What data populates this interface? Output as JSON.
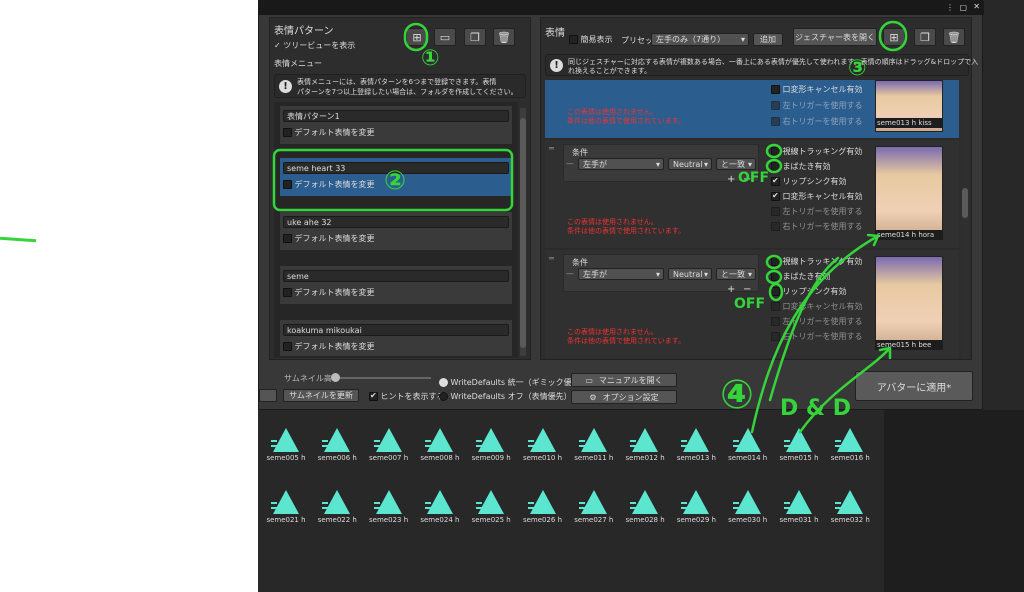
{
  "left_panel": {
    "title": "表情パターン",
    "tree_preview_label": "ツリービューを表示",
    "menu_label": "表情メニュー",
    "info_text_1": "表情メニューには、表情パターンを6つまで登録できます。表情",
    "info_text_2": "パターンを7つ以上登録したい場合は、フォルダを作成してください。",
    "default_change_label": "デフォルト表情を変更",
    "patterns": [
      {
        "name": "表情パターン1"
      },
      {
        "name": "seme heart 33"
      },
      {
        "name": "uke ahe 32"
      },
      {
        "name": "seme"
      },
      {
        "name": "koakuma mikoukai"
      }
    ]
  },
  "right_panel": {
    "title": "表情",
    "simple_display_label": "簡易表示",
    "preset_label": "プリセット",
    "preset_value": "左手のみ（7通り）",
    "add_label": "追加",
    "gesture_table_label": "ジェスチャー表を開く",
    "info_text_1": "同じジェスチャーに対応する表情が複数ある場合、一番上にある表情が優先して使われます。表情の順序はドラッグ&ドロップで入",
    "info_text_2": "れ換えることができます。",
    "condition_label": "条件",
    "hand_value": "左手が",
    "gesture_value": "Neutral",
    "match_value": "と一致",
    "warning_line_1": "この表情は使用されません。",
    "warning_line_2": "条件は他の表情で使用されています。",
    "options": {
      "eye_tracking": "視線トラッキング有効",
      "blink": "まばたき有効",
      "lip_sync": "リップシンク有効",
      "mouth_cancel": "口変形キャンセル有効",
      "left_trigger": "左トリガーを使用する",
      "right_trigger": "右トリガーを使用する"
    },
    "thumbnails": [
      {
        "caption": "seme013 h kiss"
      },
      {
        "caption": "seme014 h hora"
      },
      {
        "caption": "seme015 h bee"
      }
    ]
  },
  "bottom_bar": {
    "thumb_height_label": "サムネイル高",
    "update_thumb_label": "サムネイルを更新",
    "hint_label": "ヒントを表示する",
    "wd_on_label": "WriteDefaults 統一（ギミック優先）",
    "wd_off_label": "WriteDefaults オフ（表情優先）",
    "manual_label": "マニュアルを開く",
    "option_label": "オプション設定",
    "apply_label": "アバターに適用*"
  },
  "assets_row1": [
    "seme005 h",
    "seme006 h",
    "seme007 h",
    "seme008 h",
    "seme009 h",
    "seme010 h",
    "seme011 h",
    "seme012 h",
    "seme013 h",
    "seme014 h",
    "seme015 h",
    "seme016 h"
  ],
  "assets_row2": [
    "seme021 h",
    "seme022 h",
    "seme023 h",
    "seme024 h",
    "seme025 h",
    "seme026 h",
    "seme027 h",
    "seme028 h",
    "seme029 h",
    "seme030 h",
    "seme031 h",
    "seme032 h"
  ],
  "annotations": {
    "one": "①",
    "two": "②",
    "three": "③",
    "four": "④",
    "off": "OFF",
    "dd": "D & D"
  },
  "colors": {
    "accent_green": "#35d43a",
    "asset_teal": "#5ce6d0",
    "selected_blue": "#2c5d8f"
  }
}
